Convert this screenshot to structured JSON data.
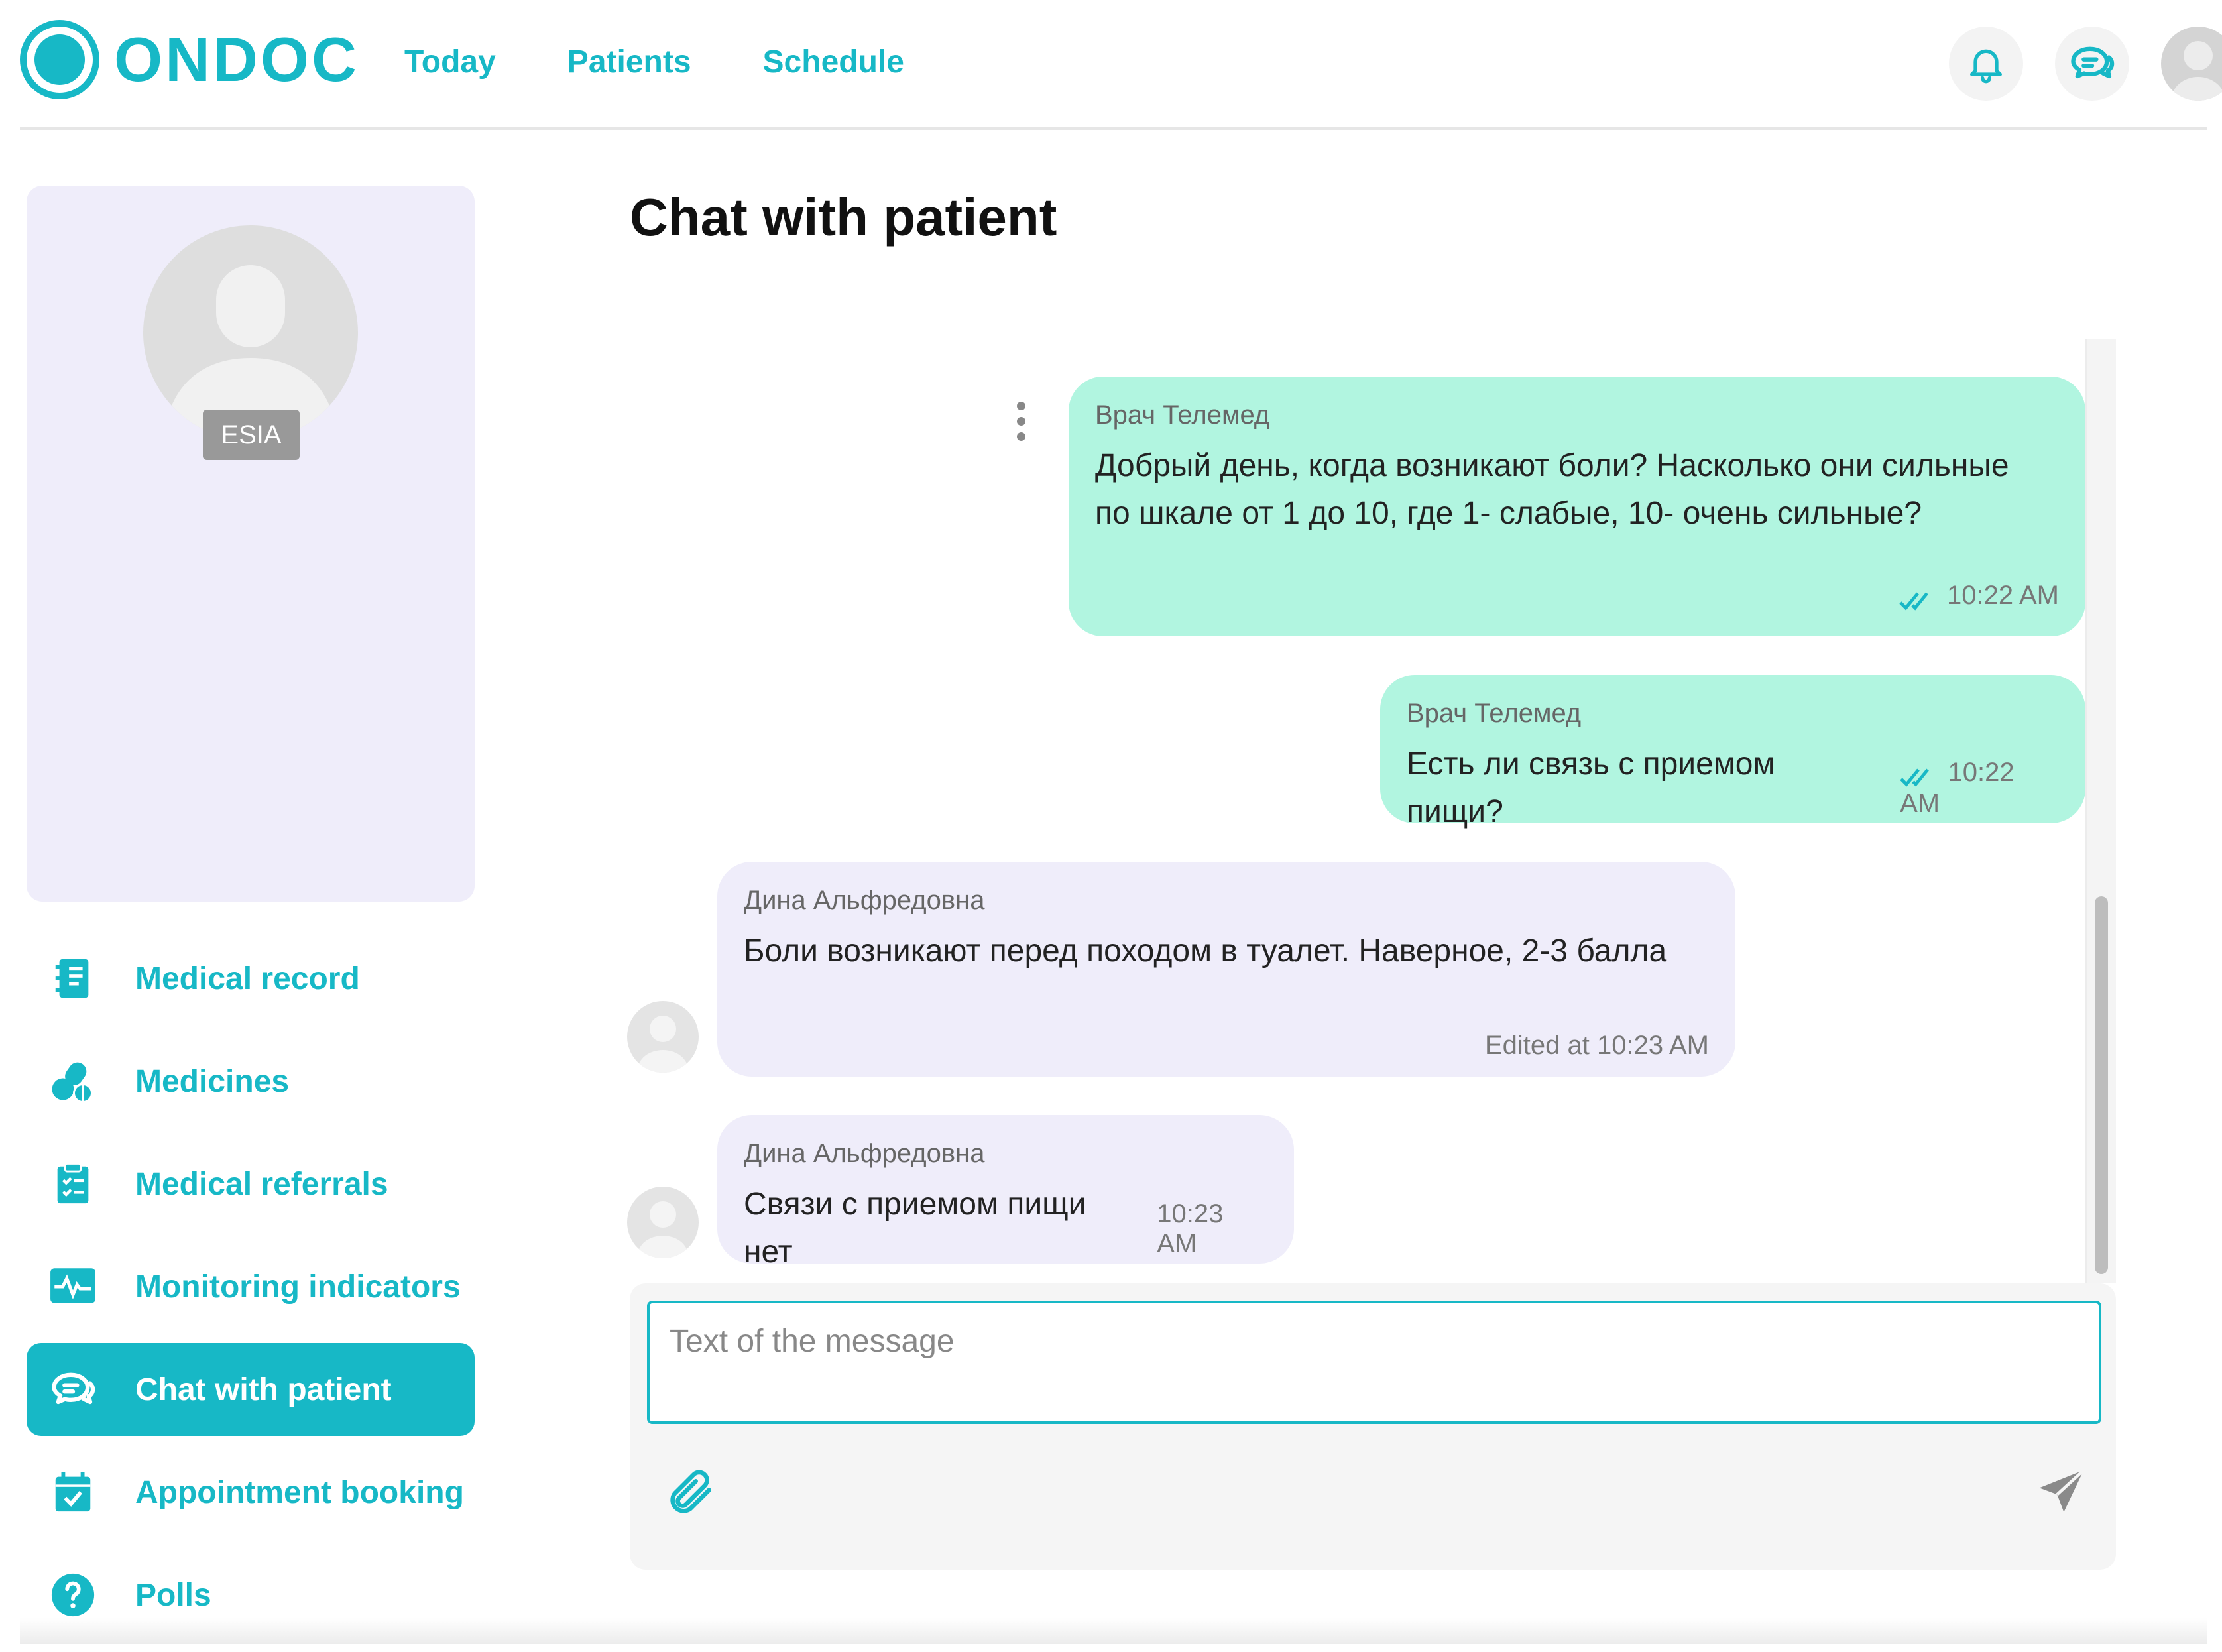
{
  "app": {
    "brand": "ONDOC",
    "accent_color": "#17b8c6"
  },
  "nav": {
    "items": [
      {
        "label": "Today"
      },
      {
        "label": "Patients"
      },
      {
        "label": "Schedule"
      }
    ]
  },
  "header_icons": [
    "bell-icon",
    "chat-icon",
    "user-avatar"
  ],
  "profile": {
    "badge": "ESIA"
  },
  "sidebar": {
    "items": [
      {
        "label": "Medical record",
        "icon": "medical-record-icon",
        "active": false
      },
      {
        "label": "Medicines",
        "icon": "medicines-icon",
        "active": false
      },
      {
        "label": "Medical referrals",
        "icon": "clipboard-icon",
        "active": false
      },
      {
        "label": "Monitoring indicators",
        "icon": "monitor-icon",
        "active": false
      },
      {
        "label": "Chat with patient",
        "icon": "chat-icon",
        "active": true
      },
      {
        "label": "Appointment booking",
        "icon": "calendar-icon",
        "active": false
      },
      {
        "label": "Polls",
        "icon": "question-icon",
        "active": false
      }
    ]
  },
  "page": {
    "title": "Chat with patient"
  },
  "messages": [
    {
      "sender": "Врач Телемед",
      "text": "Добрый день, когда возникают боли? Насколько они сильные по шкале от 1 до 10, где 1- слабые, 10- очень сильные?",
      "time": "10:22 AM",
      "side": "doctor",
      "read": true
    },
    {
      "sender": "Врач Телемед",
      "text": "Есть ли связь с приемом пищи?",
      "time": "10:22 AM",
      "side": "doctor",
      "read": true
    },
    {
      "sender": "Дина Альфредовна",
      "text": "Боли возникают перед походом в туалет. Наверное, 2-3 балла",
      "time": "Edited at 10:23 AM",
      "side": "patient"
    },
    {
      "sender": "Дина Альфредовна",
      "text": "Связи с приемом пищи нет",
      "time": "10:23 AM",
      "side": "patient"
    }
  ],
  "composer": {
    "placeholder": "Text of the message",
    "value": ""
  }
}
